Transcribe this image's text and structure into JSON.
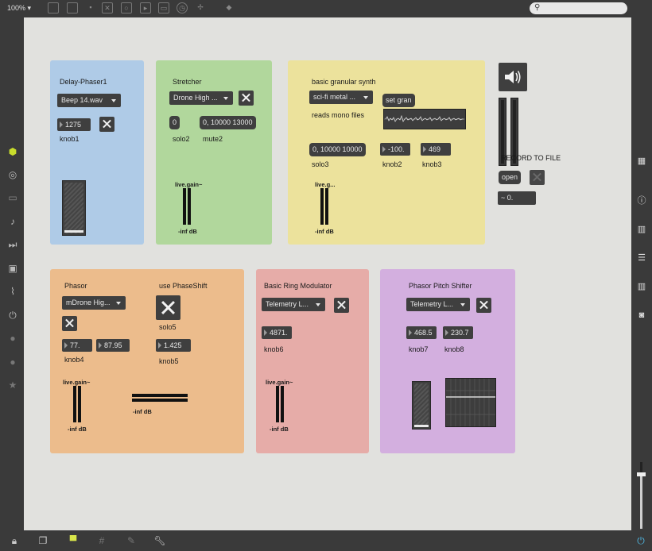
{
  "toolbar": {
    "zoom": "100% ▾"
  },
  "panels": {
    "delay": {
      "title": "Delay-Phaser1",
      "menu": "Beep 14.wav",
      "knob1_value": "1275",
      "knob1_label": "knob1"
    },
    "stretcher": {
      "title": "Stretcher",
      "menu": "Drone High ...",
      "solo_value": "0",
      "list_value": "0, 10000 13000",
      "solo_label": "solo2",
      "mute_label": "mute2",
      "gain_label": "live.gain~",
      "db_label": "-inf dB"
    },
    "granular": {
      "title": "basic granular synth",
      "menu": "sci-fi metal ...",
      "set_msg": "set gran",
      "reads": "reads mono files",
      "list_value": "0, 10000 10000",
      "knob2_value": "-100.",
      "knob3_value": "469",
      "solo_label": "solo3",
      "knob2_label": "knob2",
      "knob3_label": "knob3",
      "gain_label": "live.g...",
      "db_label": "-inf dB"
    },
    "record": {
      "title": "RECORD TO FILE",
      "open_msg": "open",
      "signal_value": "~ 0."
    },
    "phasor": {
      "title": "Phasor",
      "menu": "mDrone Hig...",
      "knob4_value": "77.",
      "knob_extra_value": "87.95",
      "knob4_label": "knob4",
      "gain_label": "live.gain~",
      "db_label": "-inf dB",
      "db_label2": "-inf dB"
    },
    "phaseshift": {
      "title": "use PhaseShift",
      "solo_label": "solo5",
      "knob5_value": "1.425",
      "knob5_label": "knob5"
    },
    "ring": {
      "title": "Basic Ring Modulator",
      "menu": "Telemetry L...",
      "knob6_value": "4871.",
      "knob6_label": "knob6",
      "gain_label": "live.gain~",
      "db_label": "-inf dB"
    },
    "pitch": {
      "title": "Phasor Pitch Shifter",
      "menu": "Telemetry L...",
      "knob7_value": "468.5",
      "knob8_value": "230.7",
      "knob7_label": "knob7",
      "knob8_label": "knob8"
    }
  }
}
